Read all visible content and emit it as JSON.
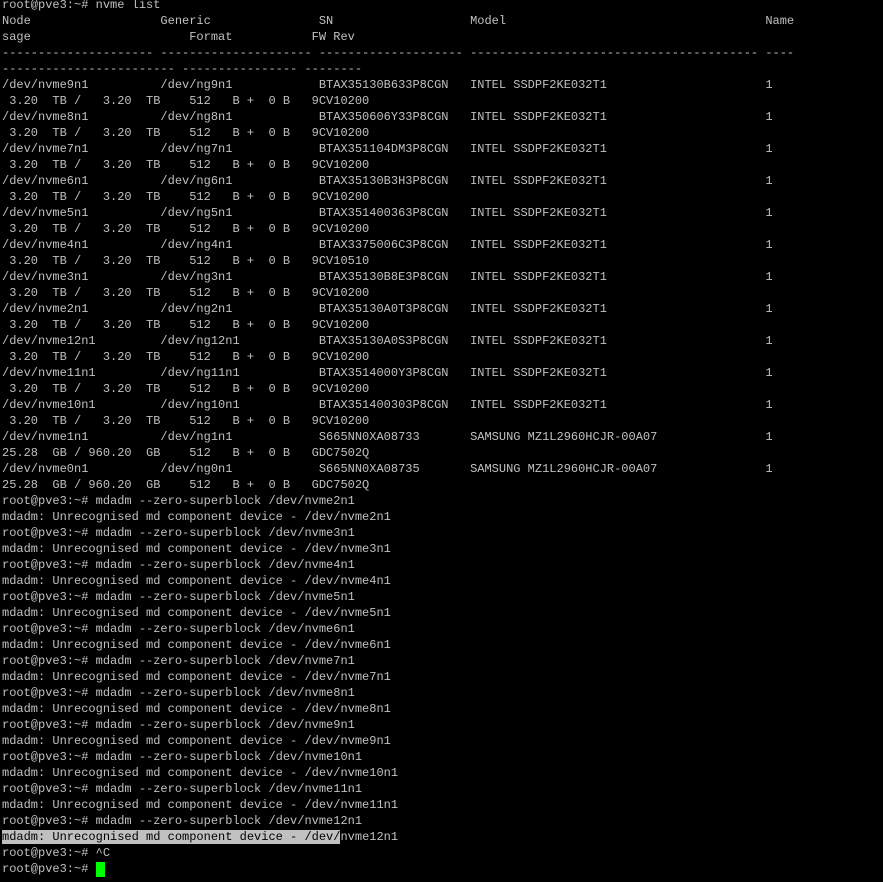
{
  "terminal": {
    "colors": {
      "background": "#000000",
      "foreground": "#c0c0c0",
      "selection_bg": "#c0c0c0",
      "selection_fg": "#000000",
      "cursor": "#00ff00"
    },
    "cursor_prompt": "root@pve3:~# ",
    "lines": [
      "root@pve3:~# nvme list",
      "Node                  Generic               SN                   Model                                    Name",
      "sage                      Format           FW Rev",
      "--------------------- --------------------- -------------------- ---------------------------------------- ----",
      "------------------------ ---------------- --------",
      "/dev/nvme9n1          /dev/ng9n1            BTAX35130B633P8CGN   INTEL SSDPF2KE032T1                      1",
      " 3.20  TB /   3.20  TB    512   B +  0 B   9CV10200",
      "/dev/nvme8n1          /dev/ng8n1            BTAX350606Y33P8CGN   INTEL SSDPF2KE032T1                      1",
      " 3.20  TB /   3.20  TB    512   B +  0 B   9CV10200",
      "/dev/nvme7n1          /dev/ng7n1            BTAX351104DM3P8CGN   INTEL SSDPF2KE032T1                      1",
      " 3.20  TB /   3.20  TB    512   B +  0 B   9CV10200",
      "/dev/nvme6n1          /dev/ng6n1            BTAX35130B3H3P8CGN   INTEL SSDPF2KE032T1                      1",
      " 3.20  TB /   3.20  TB    512   B +  0 B   9CV10200",
      "/dev/nvme5n1          /dev/ng5n1            BTAX351400363P8CGN   INTEL SSDPF2KE032T1                      1",
      " 3.20  TB /   3.20  TB    512   B +  0 B   9CV10200",
      "/dev/nvme4n1          /dev/ng4n1            BTAX3375006C3P8CGN   INTEL SSDPF2KE032T1                      1",
      " 3.20  TB /   3.20  TB    512   B +  0 B   9CV10510",
      "/dev/nvme3n1          /dev/ng3n1            BTAX35130B8E3P8CGN   INTEL SSDPF2KE032T1                      1",
      " 3.20  TB /   3.20  TB    512   B +  0 B   9CV10200",
      "/dev/nvme2n1          /dev/ng2n1            BTAX35130A0T3P8CGN   INTEL SSDPF2KE032T1                      1",
      " 3.20  TB /   3.20  TB    512   B +  0 B   9CV10200",
      "/dev/nvme12n1         /dev/ng12n1           BTAX35130A0S3P8CGN   INTEL SSDPF2KE032T1                      1",
      " 3.20  TB /   3.20  TB    512   B +  0 B   9CV10200",
      "/dev/nvme11n1         /dev/ng11n1           BTAX3514000Y3P8CGN   INTEL SSDPF2KE032T1                      1",
      " 3.20  TB /   3.20  TB    512   B +  0 B   9CV10200",
      "/dev/nvme10n1         /dev/ng10n1           BTAX351400303P8CGN   INTEL SSDPF2KE032T1                      1",
      " 3.20  TB /   3.20  TB    512   B +  0 B   9CV10200",
      "/dev/nvme1n1          /dev/ng1n1            S665NN0XA08733       SAMSUNG MZ1L2960HCJR-00A07               1",
      "25.28  GB / 960.20  GB    512   B +  0 B   GDC7502Q",
      "/dev/nvme0n1          /dev/ng0n1            S665NN0XA08735       SAMSUNG MZ1L2960HCJR-00A07               1",
      "25.28  GB / 960.20  GB    512   B +  0 B   GDC7502Q",
      "root@pve3:~# mdadm --zero-superblock /dev/nvme2n1",
      "mdadm: Unrecognised md component device - /dev/nvme2n1",
      "root@pve3:~# mdadm --zero-superblock /dev/nvme3n1",
      "mdadm: Unrecognised md component device - /dev/nvme3n1",
      "root@pve3:~# mdadm --zero-superblock /dev/nvme4n1",
      "mdadm: Unrecognised md component device - /dev/nvme4n1",
      "root@pve3:~# mdadm --zero-superblock /dev/nvme5n1",
      "mdadm: Unrecognised md component device - /dev/nvme5n1",
      "root@pve3:~# mdadm --zero-superblock /dev/nvme6n1",
      "mdadm: Unrecognised md component device - /dev/nvme6n1",
      "root@pve3:~# mdadm --zero-superblock /dev/nvme7n1",
      "mdadm: Unrecognised md component device - /dev/nvme7n1",
      "root@pve3:~# mdadm --zero-superblock /dev/nvme8n1",
      "mdadm: Unrecognised md component device - /dev/nvme8n1",
      "root@pve3:~# mdadm --zero-superblock /dev/nvme9n1",
      "mdadm: Unrecognised md component device - /dev/nvme9n1",
      "root@pve3:~# mdadm --zero-superblock /dev/nvme10n1",
      "mdadm: Unrecognised md component device - /dev/nvme10n1",
      "root@pve3:~# mdadm --zero-superblock /dev/nvme11n1",
      "mdadm: Unrecognised md component device - /dev/nvme11n1",
      "root@pve3:~# mdadm --zero-superblock /dev/nvme12n1"
    ],
    "selected_line": {
      "selected_text": "mdadm: Unrecognised md component device - /dev/",
      "rest_text": "nvme12n1"
    },
    "interrupt_line": "root@pve3:~# ^C"
  }
}
